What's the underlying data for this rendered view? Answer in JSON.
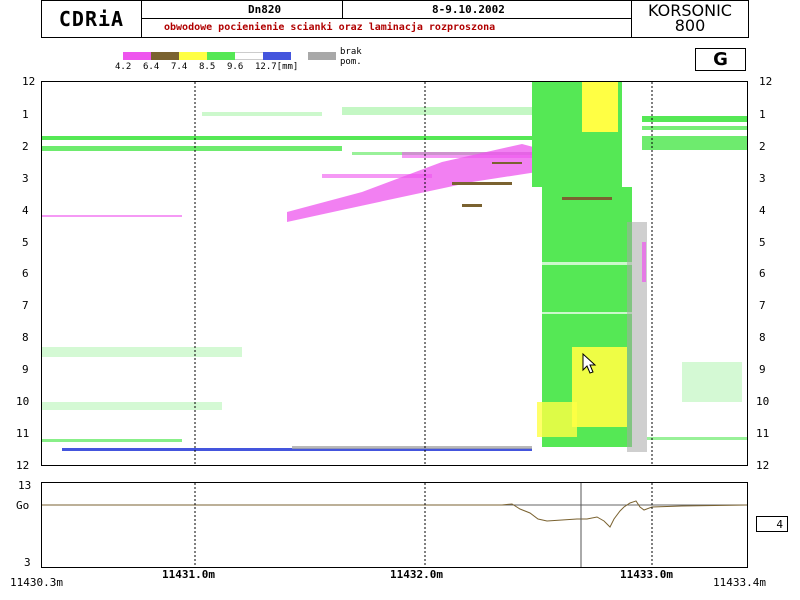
{
  "header": {
    "logo": "CDRiA",
    "pipe": "Dn820",
    "date": "8-9.10.2002",
    "subtitle": "obwodowe pocienienie scianki oraz laminacja rozproszona",
    "brand_line1": "KORSONIC",
    "brand_line2": "800"
  },
  "legend": {
    "ticks": [
      "4.2",
      "6.4",
      "7.4",
      "8.5",
      "9.6",
      "12.7[mm]"
    ],
    "colors": [
      "#ee55ee",
      "#7a6230",
      "#ffff44",
      "#55e855",
      "#ffffff",
      "#4455dd"
    ],
    "missing_label_1": "brak",
    "missing_label_2": "pom.",
    "missing_color": "#a8a8a8"
  },
  "view_mode_button": "G",
  "map": {
    "y_labels": [
      "12",
      "1",
      "2",
      "3",
      "4",
      "5",
      "6",
      "7",
      "8",
      "9",
      "10",
      "11",
      "12"
    ]
  },
  "profile": {
    "y_top": "13",
    "y_ref": "Go",
    "y_bottom": "3",
    "scale_box": "4"
  },
  "x_axis": {
    "start": "11430.3m",
    "end": "11433.4m",
    "marks": [
      "11431.0m",
      "11432.0m",
      "11433.0m"
    ]
  }
}
